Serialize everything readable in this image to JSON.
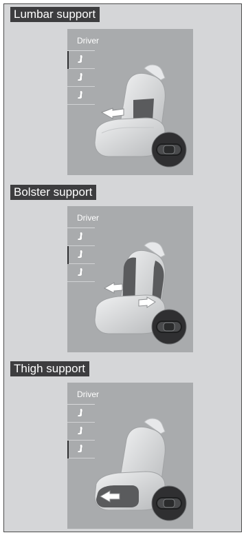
{
  "sections": [
    {
      "title": "Lumbar support",
      "panel_label": "Driver",
      "active_tab": 1,
      "highlight": "lumbar"
    },
    {
      "title": "Bolster support",
      "panel_label": "Driver",
      "active_tab": 2,
      "highlight": "bolster"
    },
    {
      "title": "Thigh support",
      "panel_label": "Driver",
      "active_tab": 3,
      "highlight": "thigh"
    }
  ],
  "icons": {
    "seat_tab": "seat-icon",
    "arrow": "arrow-icon",
    "dial": "seat-control-dial-icon"
  },
  "colors": {
    "panel": "#a9abad",
    "header": "#3d3d3f",
    "background": "#d5d6d8",
    "highlight": "#5a5b5d",
    "dial": "#2f2f31"
  }
}
